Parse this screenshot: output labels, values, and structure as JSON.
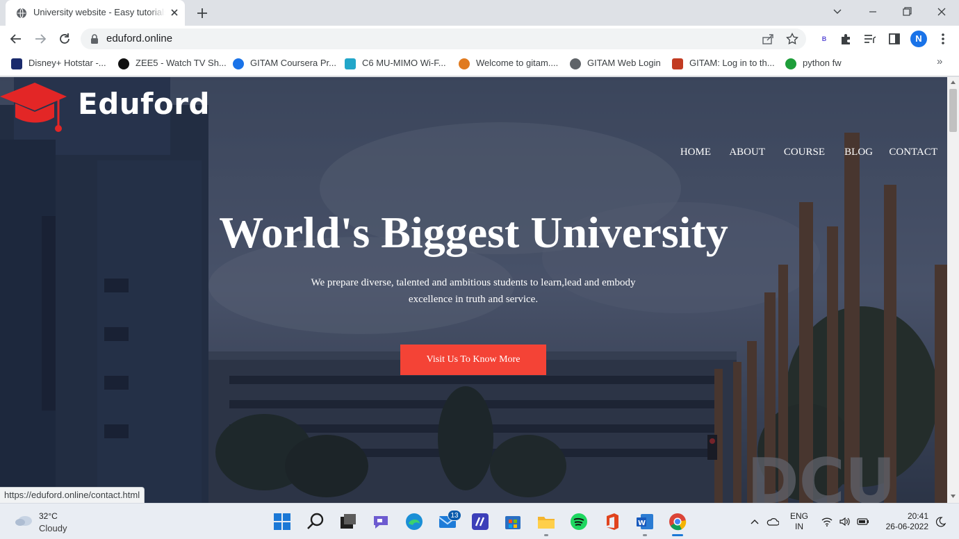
{
  "browser": {
    "tab": {
      "title": "University website - Easy tutorials",
      "favicon": "globe-icon"
    },
    "url": "eduford.online",
    "profile_initial": "N",
    "extension_label": "B",
    "bookmarks": [
      {
        "label": "Disney+ Hotstar -...",
        "icon": "hotstar-icon",
        "color": "#1a2a6c"
      },
      {
        "label": "ZEE5 - Watch TV Sh...",
        "icon": "zee5-icon",
        "color": "#111111"
      },
      {
        "label": "GITAM Coursera Pr...",
        "icon": "coursera-icon",
        "color": "#1a73e8"
      },
      {
        "label": "C6 MU-MIMO Wi-F...",
        "icon": "router-icon",
        "color": "#22a6c9"
      },
      {
        "label": "Welcome to gitam....",
        "icon": "gitam-sun-icon",
        "color": "#e07a1f"
      },
      {
        "label": "GITAM Web Login",
        "icon": "globe-icon",
        "color": "#5f6368"
      },
      {
        "label": "GITAM: Log in to th...",
        "icon": "gitam-logo-icon",
        "color": "#c23b22"
      },
      {
        "label": "python fw",
        "icon": "spiral-icon",
        "color": "#1e9e3a"
      }
    ]
  },
  "page": {
    "brand": "Eduford",
    "nav": [
      "HOME",
      "ABOUT",
      "COURSE",
      "BLOG",
      "CONTACT"
    ],
    "hero_title": "World's Biggest University",
    "hero_subtitle": "We prepare diverse, talented and ambitious students to learn,lead and embody excellence in truth and service.",
    "cta": "Visit Us To Know More",
    "accent_color": "#f44336",
    "status_url": "https://eduford.online/contact.html"
  },
  "taskbar": {
    "weather_temp": "32°C",
    "weather_cond": "Cloudy",
    "mail_badge": "13",
    "lang_top": "ENG",
    "lang_bottom": "IN",
    "time": "20:41",
    "date": "26-06-2022"
  }
}
